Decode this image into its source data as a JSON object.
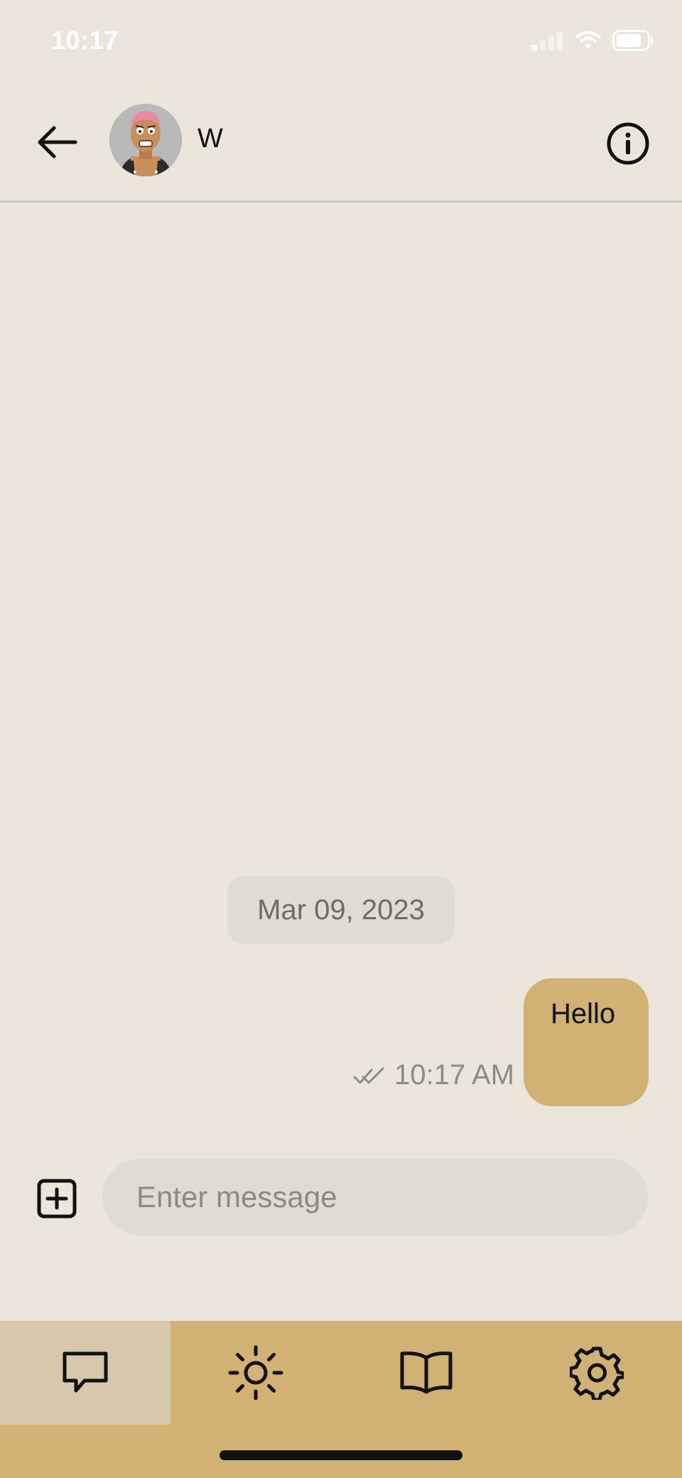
{
  "status_bar": {
    "time": "10:17"
  },
  "header": {
    "contact_name": "W",
    "back_icon": "arrow-left-icon",
    "info_icon": "info-circle-icon"
  },
  "conversation": {
    "date_label": "Mar 09, 2023",
    "messages": [
      {
        "text": "Hello",
        "time": "10:17 AM",
        "status_icon": "double-check-icon"
      }
    ]
  },
  "composer": {
    "placeholder": "Enter message",
    "value": "",
    "attach_icon": "plus-square-icon"
  },
  "bottom_nav": {
    "tabs": [
      {
        "icon": "chat-bubble-icon",
        "active": true
      },
      {
        "icon": "sun-icon",
        "active": false
      },
      {
        "icon": "book-icon",
        "active": false
      },
      {
        "icon": "gear-icon",
        "active": false
      }
    ]
  },
  "colors": {
    "background": "#ebe5db",
    "accent": "#d1b174",
    "active_tab": "#d6c7ad",
    "chip": "#e1dcd3"
  }
}
